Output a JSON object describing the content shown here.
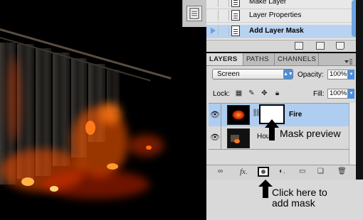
{
  "history": {
    "items": [
      {
        "label": "Make Layer",
        "selected": false
      },
      {
        "label": "Layer Properties",
        "selected": false
      },
      {
        "label": "Add Layer Mask",
        "selected": true
      }
    ]
  },
  "layers_panel": {
    "tabs": [
      {
        "label": "LAYERS",
        "active": true
      },
      {
        "label": "PATHS",
        "active": false
      },
      {
        "label": "CHANNELS",
        "active": false
      }
    ],
    "blend_mode": "Screen",
    "opacity_label": "Opacity:",
    "opacity_value": "100%",
    "lock_label": "Lock:",
    "fill_label": "Fill:",
    "fill_value": "100%",
    "layers": [
      {
        "name": "Fire",
        "selected": true,
        "has_mask": true
      },
      {
        "name": "Hou",
        "selected": false,
        "has_mask": false
      }
    ]
  },
  "annotations": {
    "mask_preview": "Mask preview",
    "click_here_line1": "Click here to",
    "click_here_line2": "add mask"
  },
  "colors": {
    "selection_blue": "#aecdf0",
    "history_selected": "#b8d3f2",
    "fire_orange": "#ff4a00"
  }
}
